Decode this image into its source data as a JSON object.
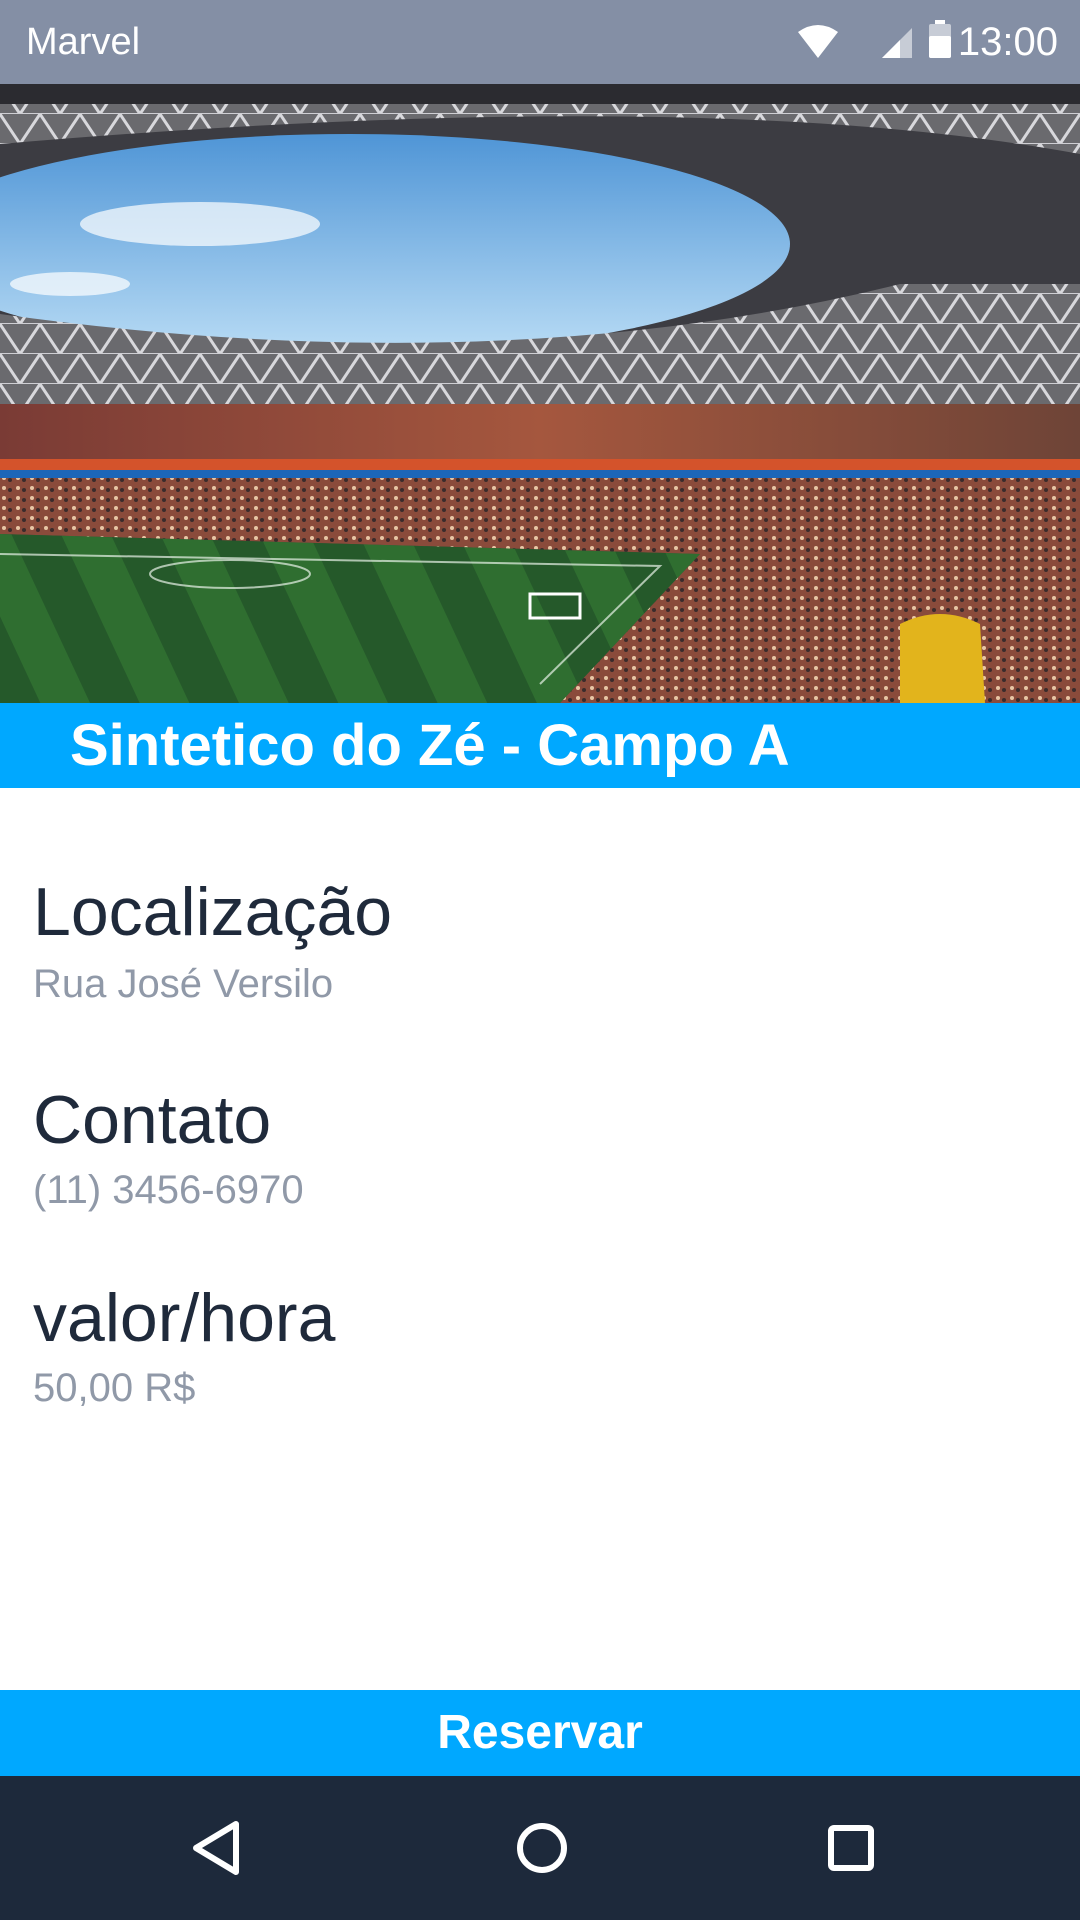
{
  "status_bar": {
    "app_name": "Marvel",
    "time": "13:00",
    "icons": [
      "wifi-icon",
      "cell-signal-icon",
      "battery-icon"
    ]
  },
  "hero": {
    "image_subject": "football stadium photo"
  },
  "venue": {
    "title": "Sintetico do Zé - Campo A"
  },
  "details": {
    "location_label": "Localização",
    "location_value": "Rua José  Versilo",
    "contact_label": "Contato",
    "contact_value": "(11) 3456-6970",
    "price_label": "valor/hora",
    "price_value": "50,00 R$"
  },
  "actions": {
    "reserve_label": "Reservar"
  },
  "nav": {
    "icons": [
      "back-icon",
      "home-icon",
      "recents-icon"
    ]
  },
  "colors": {
    "accent": "#00a8ff",
    "status_bar": "#848fa5",
    "nav_bar": "#1d293b",
    "label_text": "#1f2a3b",
    "value_text": "#9099a8"
  }
}
